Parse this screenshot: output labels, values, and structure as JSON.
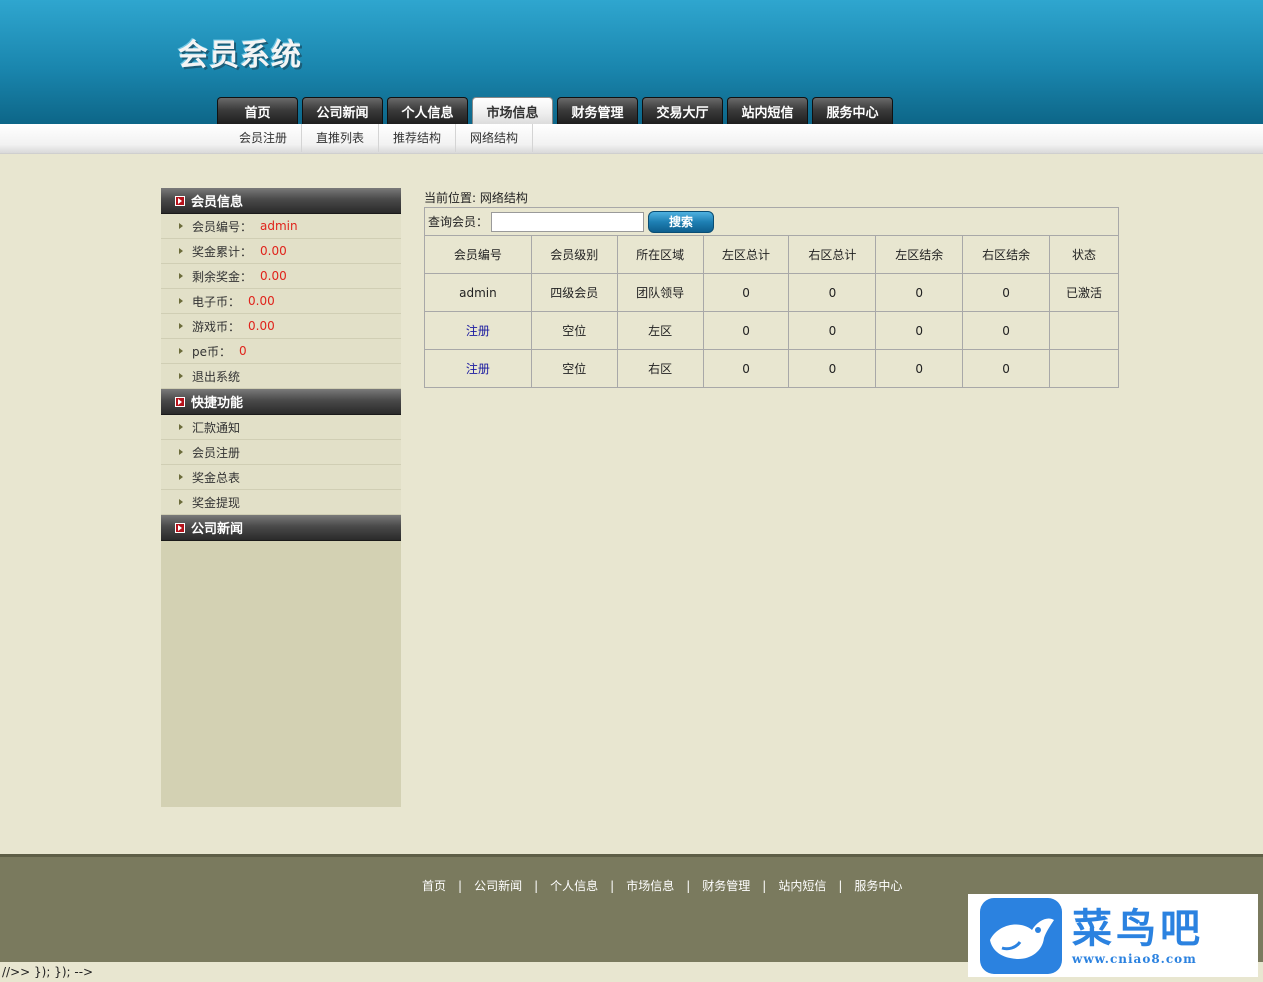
{
  "header": {
    "logo": "会员系统",
    "tabs": [
      "首页",
      "公司新闻",
      "个人信息",
      "市场信息",
      "财务管理",
      "交易大厅",
      "站内短信",
      "服务中心"
    ],
    "active_tab": 3
  },
  "subnav": [
    "会员注册",
    "直推列表",
    "推荐结构",
    "网络结构"
  ],
  "sidebar": {
    "member_info": {
      "title": "会员信息",
      "rows": [
        {
          "label": "会员编号：",
          "value": "admin"
        },
        {
          "label": "奖金累计：",
          "value": "0.00"
        },
        {
          "label": "剩余奖金：",
          "value": "0.00"
        },
        {
          "label": "电子币：",
          "value": "0.00"
        },
        {
          "label": "游戏币：",
          "value": "0.00"
        },
        {
          "label": "pe币：",
          "value": "0"
        }
      ],
      "logout": "退出系统"
    },
    "quick": {
      "title": "快捷功能",
      "items": [
        "汇款通知",
        "会员注册",
        "奖金总表",
        "奖金提现"
      ]
    },
    "news": {
      "title": "公司新闻"
    }
  },
  "main": {
    "breadcrumb": "当前位置: 网络结构",
    "search": {
      "label": "查询会员：",
      "value": "",
      "button": "搜索"
    },
    "table": {
      "headers": [
        "会员编号",
        "会员级别",
        "所在区域",
        "左区总计",
        "右区总计",
        "左区结余",
        "右区结余",
        "状态"
      ],
      "rows": [
        [
          "admin",
          "四级会员",
          "团队领导",
          "0",
          "0",
          "0",
          "0",
          "已激活"
        ],
        [
          "注册",
          "空位",
          "左区",
          "0",
          "0",
          "0",
          "0",
          ""
        ],
        [
          "注册",
          "空位",
          "右区",
          "0",
          "0",
          "0",
          "0",
          ""
        ]
      ]
    }
  },
  "footer": {
    "links": [
      "首页",
      "公司新闻",
      "个人信息",
      "市场信息",
      "财务管理",
      "站内短信",
      "服务中心"
    ],
    "separator": "|"
  },
  "bottom_text": "//>> }); }); -->",
  "watermark": {
    "brand": "菜鸟吧",
    "url": "www.cniao8.com"
  }
}
